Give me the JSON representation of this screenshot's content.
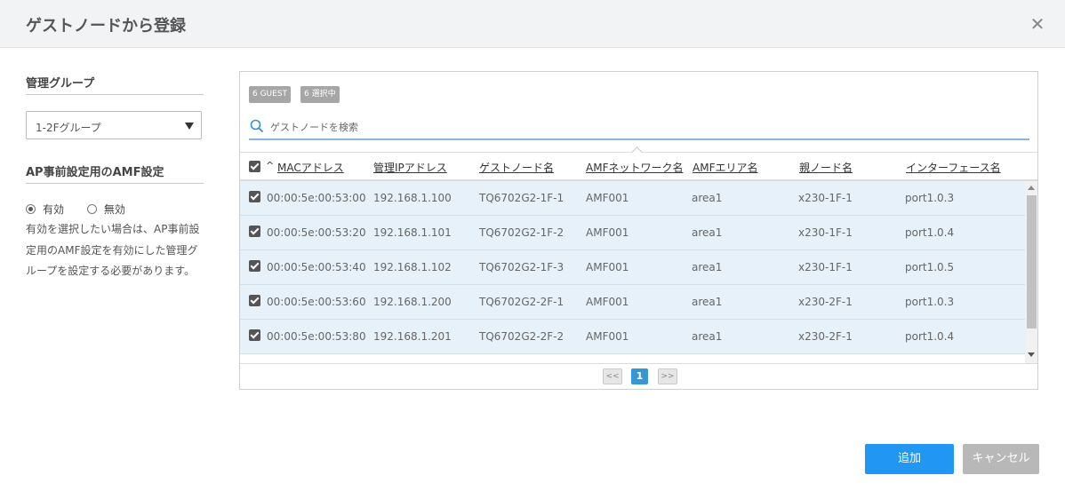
{
  "dialog": {
    "title": "ゲストノードから登録"
  },
  "left": {
    "group_title": "管理グループ",
    "group_select_value": "1-2Fグループ",
    "amf_title": "AP事前設定用のAMF設定",
    "radio_enabled": "有効",
    "radio_disabled": "無効",
    "selected": "有効",
    "note": "有効を選択したい場合は、AP事前設定用のAMF設定を有効にした管理グループを設定する必要があります。"
  },
  "table": {
    "badges": {
      "guest": "6  GUEST",
      "selected": "6  選択中"
    },
    "search_placeholder": "ゲストノードを検索",
    "sort_indicator": "^",
    "columns": [
      "MACアドレス",
      "管理IPアドレス",
      "ゲストノード名",
      "AMFネットワーク名",
      "AMFエリア名",
      "親ノード名",
      "インターフェース名"
    ],
    "rows": [
      [
        "00:00:5e:00:53:00",
        "192.168.1.100",
        "TQ6702G2-1F-1",
        "AMF001",
        "area1",
        "x230-1F-1",
        "port1.0.3"
      ],
      [
        "00:00:5e:00:53:20",
        "192.168.1.101",
        "TQ6702G2-1F-2",
        "AMF001",
        "area1",
        "x230-1F-1",
        "port1.0.4"
      ],
      [
        "00:00:5e:00:53:40",
        "192.168.1.102",
        "TQ6702G2-1F-3",
        "AMF001",
        "area1",
        "x230-1F-1",
        "port1.0.5"
      ],
      [
        "00:00:5e:00:53:60",
        "192.168.1.200",
        "TQ6702G2-2F-1",
        "AMF001",
        "area1",
        "x230-2F-1",
        "port1.0.3"
      ],
      [
        "00:00:5e:00:53:80",
        "192.168.1.201",
        "TQ6702G2-2F-2",
        "AMF001",
        "area1",
        "x230-2F-1",
        "port1.0.4"
      ]
    ]
  },
  "pagination": {
    "prev": "<<",
    "current": "1",
    "next": ">>"
  },
  "buttons": {
    "add": "追加",
    "cancel": "キャンセル"
  },
  "colors": {
    "primary": "#2196f3",
    "row_selected": "#e6f1fa",
    "disabled": "#b8b8b8"
  }
}
